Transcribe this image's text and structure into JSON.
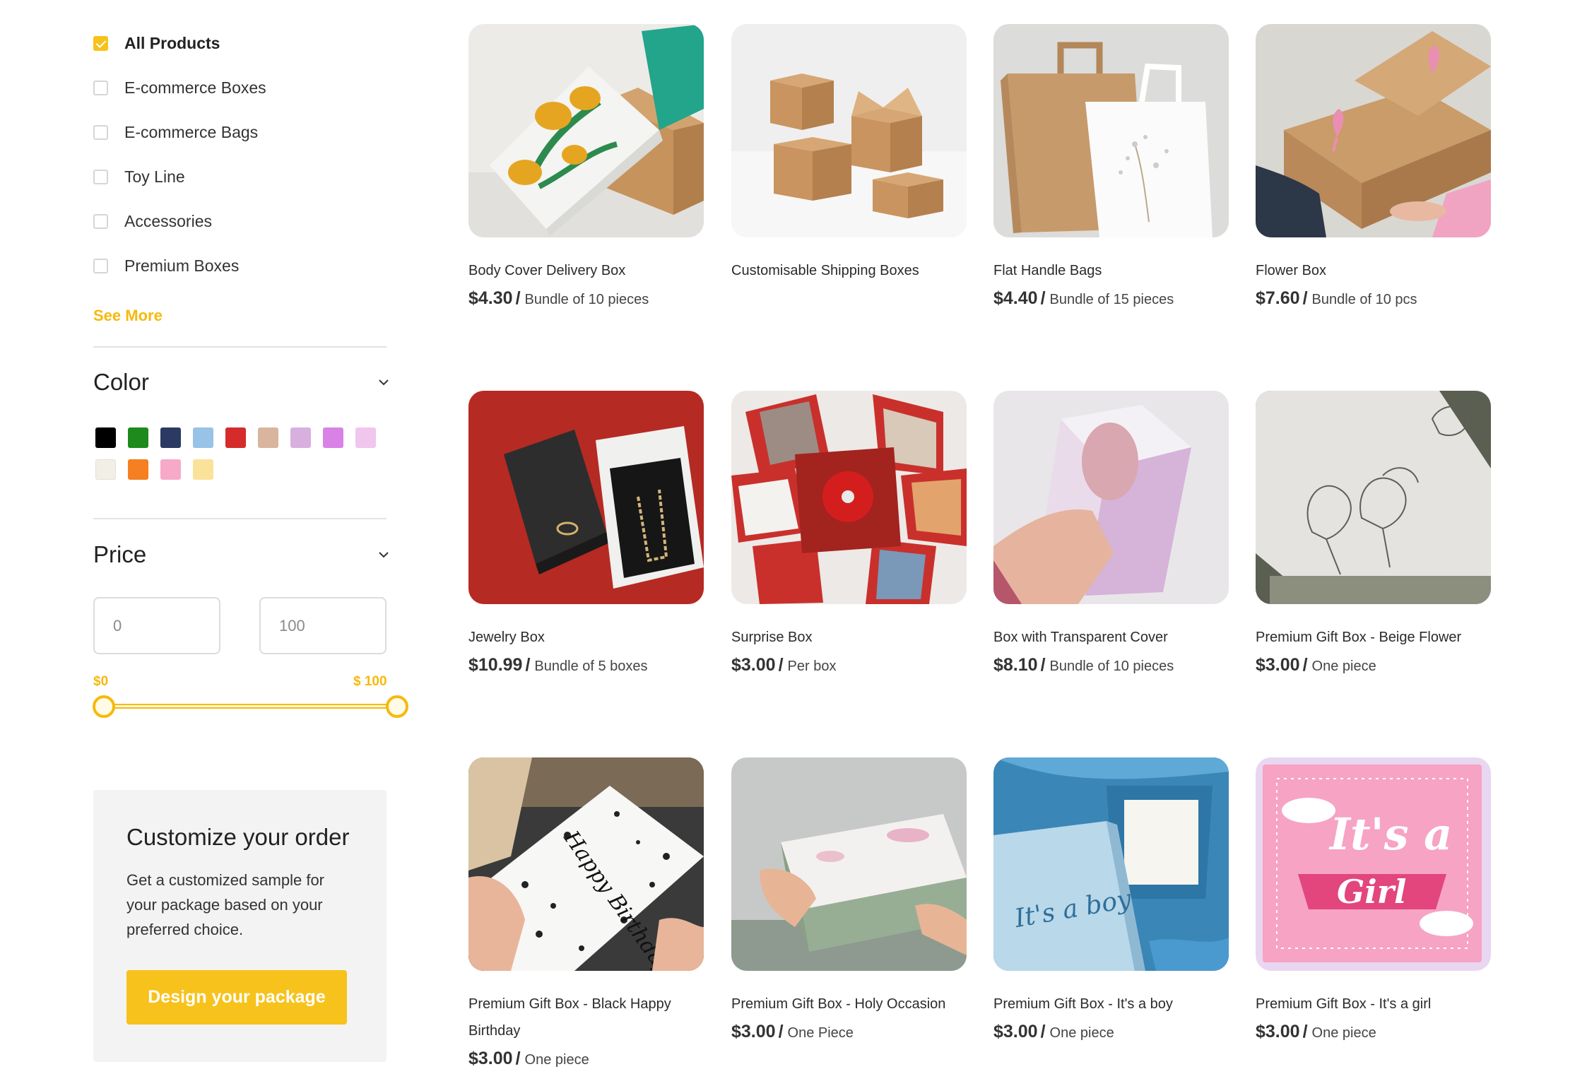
{
  "filters": {
    "categories": [
      {
        "label": "All Products",
        "checked": true
      },
      {
        "label": "E-commerce Boxes",
        "checked": false
      },
      {
        "label": "E-commerce Bags",
        "checked": false
      },
      {
        "label": "Toy Line",
        "checked": false
      },
      {
        "label": "Accessories",
        "checked": false
      },
      {
        "label": "Premium Boxes",
        "checked": false
      }
    ],
    "see_more": "See More",
    "color": {
      "title": "Color",
      "swatches": [
        "#000000",
        "#1c8a1c",
        "#2b3a63",
        "#98c2e6",
        "#d62b2b",
        "#d8b59c",
        "#d8b0e0",
        "#d982e6",
        "#f1c6ec",
        "#f1efe6",
        "#f57f21",
        "#f7a9c8",
        "#fbe29a"
      ]
    },
    "price": {
      "title": "Price",
      "min_value": "0",
      "max_value": "100",
      "min_label": "$0",
      "max_label": "$ 100"
    }
  },
  "customize": {
    "title": "Customize your order",
    "text": "Get a customized sample for your package based on your preferred choice.",
    "button": "Design your package"
  },
  "products": [
    {
      "name": "Body Cover Delivery Box",
      "price": "$4.30",
      "unit": "Bundle of 10 pieces"
    },
    {
      "name": "Customisable Shipping Boxes",
      "price": "",
      "unit": ""
    },
    {
      "name": "Flat Handle Bags",
      "price": "$4.40",
      "unit": "Bundle of 15 pieces"
    },
    {
      "name": "Flower Box",
      "price": "$7.60",
      "unit": "Bundle of 10 pcs"
    },
    {
      "name": "Jewelry Box",
      "price": "$10.99",
      "unit": "Bundle of 5 boxes"
    },
    {
      "name": "Surprise Box",
      "price": "$3.00",
      "unit": "Per box"
    },
    {
      "name": "Box with Transparent Cover",
      "price": "$8.10",
      "unit": "Bundle of 10 pieces"
    },
    {
      "name": "Premium Gift Box - Beige Flower",
      "price": "$3.00",
      "unit": "One piece"
    },
    {
      "name": "Premium Gift Box - Black Happy Birthday",
      "price": "$3.00",
      "unit": "One piece"
    },
    {
      "name": "Premium Gift Box - Holy Occasion",
      "price": "$3.00",
      "unit": "One Piece"
    },
    {
      "name": "Premium Gift Box - It's a boy",
      "price": "$3.00",
      "unit": "One piece"
    },
    {
      "name": "Premium Gift Box - It's a girl",
      "price": "$3.00",
      "unit": "One piece"
    }
  ],
  "image_text": {
    "birthday": "Happy Birthday to you",
    "boy": "It's a boy",
    "girl_1": "It's a",
    "girl_2": "Girl"
  }
}
